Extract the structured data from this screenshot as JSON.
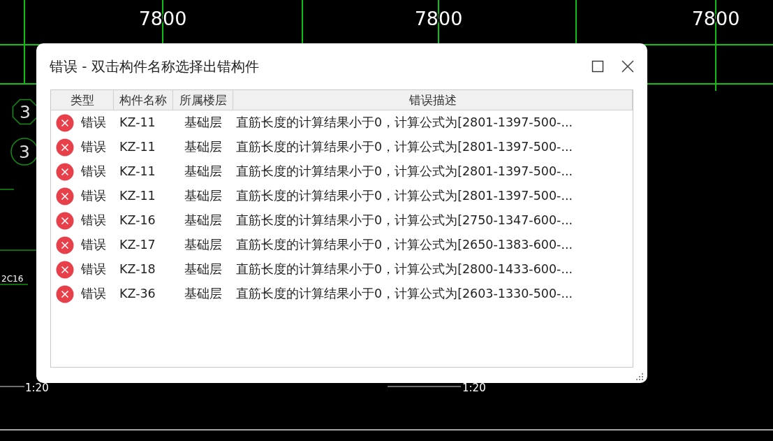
{
  "cad_drawing": {
    "dimension_labels": [
      "7800",
      "7800",
      "7800"
    ],
    "axis_labels": [
      "3",
      "3"
    ],
    "rebar_labels": [
      "2C16"
    ],
    "scale_labels": [
      "1:20",
      "1:20"
    ]
  },
  "window": {
    "title": "错误 - 双击构件名称选择出错构件"
  },
  "table": {
    "columns": [
      "类型",
      "构件名称",
      "所属楼层",
      "错误描述"
    ],
    "rows": [
      {
        "kind": "error",
        "type": "错误",
        "name": "KZ-11",
        "floor": "基础层",
        "description": "直筋长度的计算结果小于0，计算公式为[2801-1397-500-..."
      },
      {
        "kind": "error",
        "type": "错误",
        "name": "KZ-11",
        "floor": "基础层",
        "description": "直筋长度的计算结果小于0，计算公式为[2801-1397-500-..."
      },
      {
        "kind": "error",
        "type": "错误",
        "name": "KZ-11",
        "floor": "基础层",
        "description": "直筋长度的计算结果小于0，计算公式为[2801-1397-500-..."
      },
      {
        "kind": "error",
        "type": "错误",
        "name": "KZ-11",
        "floor": "基础层",
        "description": "直筋长度的计算结果小于0，计算公式为[2801-1397-500-..."
      },
      {
        "kind": "error",
        "type": "错误",
        "name": "KZ-16",
        "floor": "基础层",
        "description": "直筋长度的计算结果小于0，计算公式为[2750-1347-600-..."
      },
      {
        "kind": "error",
        "type": "错误",
        "name": "KZ-17",
        "floor": "基础层",
        "description": "直筋长度的计算结果小于0，计算公式为[2650-1383-600-..."
      },
      {
        "kind": "error",
        "type": "错误",
        "name": "KZ-18",
        "floor": "基础层",
        "description": "直筋长度的计算结果小于0，计算公式为[2800-1433-600-..."
      },
      {
        "kind": "error",
        "type": "错误",
        "name": "KZ-36",
        "floor": "基础层",
        "description": "直筋长度的计算结果小于0，计算公式为[2603-1330-500-..."
      }
    ]
  }
}
